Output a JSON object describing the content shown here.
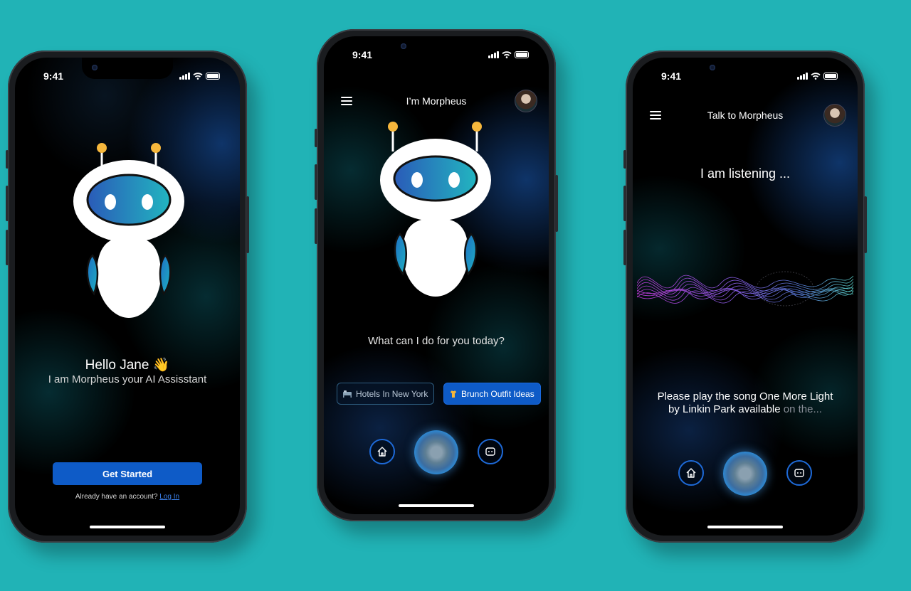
{
  "status": {
    "time": "9:41"
  },
  "screen1": {
    "greeting": "Hello Jane",
    "greeting_emoji": "👋",
    "subtitle": "I am Morpheus your AI Assisstant",
    "cta_label": "Get Started",
    "signin_prompt": "Already have an account?",
    "signin_link": "Log In"
  },
  "screen2": {
    "title": "I’m Morpheus",
    "question": "What can I do for you today?",
    "suggestions": [
      {
        "label": "Hotels In New York",
        "icon": "bed-icon",
        "style": "outline"
      },
      {
        "label": "Brunch Outfit Ideas",
        "icon": "shirt-icon",
        "style": "filled"
      }
    ],
    "nav": [
      "home-icon",
      "voice-orb",
      "chat-icon"
    ]
  },
  "screen3": {
    "title": "Talk to Morpheus",
    "listening": "I am listening ...",
    "transcript_bright": "Please play the song One More Light by Linkin Park available",
    "transcript_faded": "on the...",
    "nav": [
      "home-icon",
      "voice-orb",
      "chat-icon"
    ]
  },
  "colors": {
    "background": "#21b3b6",
    "accent": "#0e5bc7",
    "robot_antenna": "#f6b73c",
    "robot_visor": "#2a6fc0"
  }
}
